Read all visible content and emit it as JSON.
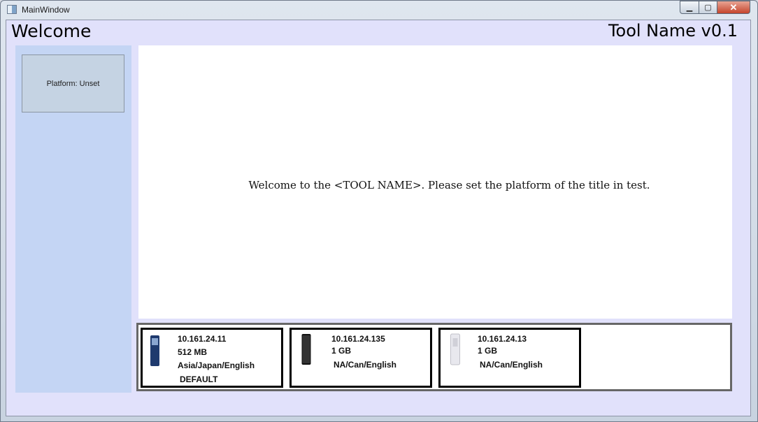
{
  "window": {
    "title": "MainWindow"
  },
  "header": {
    "left_title": "Welcome",
    "right_title": "Tool Name v0.1"
  },
  "sidebar": {
    "platform_button": "Platform: Unset"
  },
  "main": {
    "message": "Welcome to the <TOOL NAME>.  Please set the platform of the title in test."
  },
  "devices": [
    {
      "ip": "10.161.24.11",
      "memory": "512 MB",
      "region": "Asia/Japan/English",
      "tag": "DEFAULT",
      "color": "#1f3a6e"
    },
    {
      "ip": "10.161.24.135",
      "memory": "1 GB",
      "region": "NA/Can/English",
      "tag": "",
      "color": "#111111"
    },
    {
      "ip": "10.161.24.13",
      "memory": "1 GB",
      "region": "NA/Can/English",
      "tag": "",
      "color": "#e8e8ee"
    }
  ],
  "colors": {
    "client_bg": "#e1e1fb",
    "sidebar_bg": "#c4d5f4",
    "button_bg": "#c5d3e3"
  }
}
